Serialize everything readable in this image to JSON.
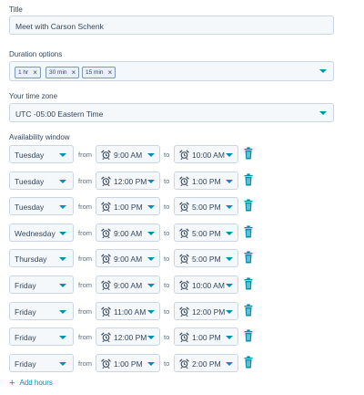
{
  "title_section": {
    "label": "Title",
    "value": "Meet with Carson Schenk"
  },
  "duration_section": {
    "label": "Duration options",
    "tags": [
      "1 hr",
      "30 min",
      "15 min"
    ]
  },
  "timezone_section": {
    "label": "Your time zone",
    "value": "UTC -05:00 Eastern Time"
  },
  "availability": {
    "label": "Availability window",
    "from_label": "from",
    "to_label": "to",
    "rows": [
      {
        "day": "Tuesday",
        "start": "9:00 AM",
        "end": "10:00 AM"
      },
      {
        "day": "Tuesday",
        "start": "12:00 PM",
        "end": "1:00 PM"
      },
      {
        "day": "Tuesday",
        "start": "1:00 PM",
        "end": "5:00 PM"
      },
      {
        "day": "Wednesday",
        "start": "9:00 AM",
        "end": "5:00 PM"
      },
      {
        "day": "Thursday",
        "start": "9:00 AM",
        "end": "5:00 PM"
      },
      {
        "day": "Friday",
        "start": "9:00 AM",
        "end": "10:00 AM"
      },
      {
        "day": "Friday",
        "start": "11:00 AM",
        "end": "12:00 PM"
      },
      {
        "day": "Friday",
        "start": "12:00 PM",
        "end": "1:00 PM"
      },
      {
        "day": "Friday",
        "start": "1:00 PM",
        "end": "2:00 PM"
      }
    ],
    "add_hours_label": "Add hours"
  },
  "icons": {
    "clock": "alarm-clock-icon",
    "trash": "trash-icon",
    "remove_tag": "close-icon",
    "dropdown": "chevron-down-icon",
    "add": "plus-icon"
  },
  "colors": {
    "accent": "#0091ae",
    "text": "#33475b",
    "field_bg": "#f5f8fa",
    "field_border": "#cbd6e2"
  }
}
